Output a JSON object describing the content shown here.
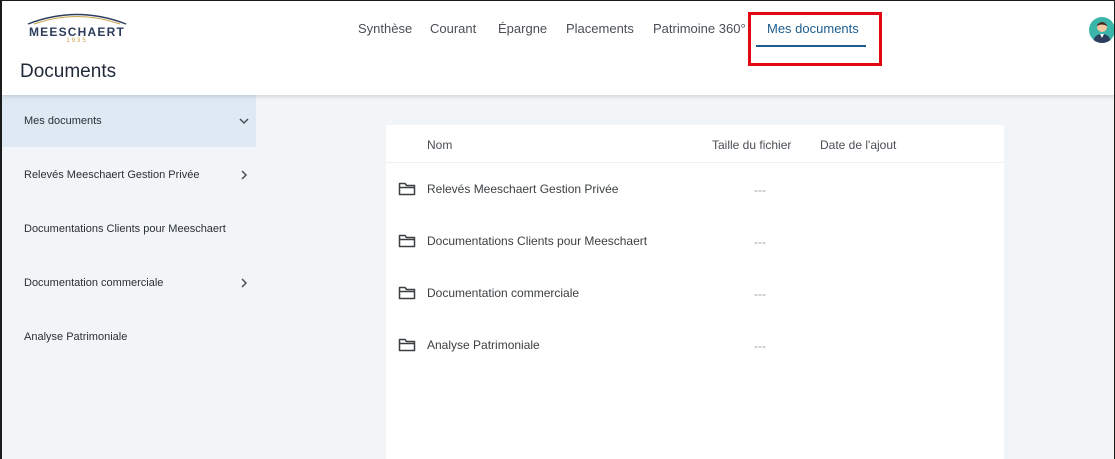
{
  "brand": {
    "name": "MEESCHAERT",
    "year": "1935"
  },
  "page": {
    "title": "Documents"
  },
  "nav": {
    "tabs": [
      {
        "label": "Synthèse"
      },
      {
        "label": "Courant"
      },
      {
        "label": "Épargne"
      },
      {
        "label": "Placements"
      },
      {
        "label": "Patrimoine 360°"
      },
      {
        "label": "Mes documents",
        "active": true
      }
    ]
  },
  "sidebar": {
    "items": [
      {
        "label": "Mes documents",
        "chevron": "chevron-down-icon",
        "active": true
      },
      {
        "label": "Relevés Meeschaert Gestion Privée",
        "chevron": "chevron-right-icon"
      },
      {
        "label": "Documentations Clients pour Meeschaert"
      },
      {
        "label": "Documentation commerciale",
        "chevron": "chevron-right-icon"
      },
      {
        "label": "Analyse Patrimoniale"
      }
    ]
  },
  "table": {
    "columns": {
      "name": "Nom",
      "size": "Taille du fichier",
      "date": "Date de l'ajout"
    },
    "rows": [
      {
        "name": "Relevés Meeschaert Gestion Privée",
        "size": "---",
        "icon": "folder-icon"
      },
      {
        "name": "Documentations Clients pour Meeschaert",
        "size": "---",
        "icon": "folder-icon"
      },
      {
        "name": "Documentation commerciale",
        "size": "---",
        "icon": "folder-icon"
      },
      {
        "name": "Analyse Patrimoniale",
        "size": "---",
        "icon": "folder-icon"
      }
    ]
  },
  "colors": {
    "accent": "#1c5d8e",
    "highlight": "#e30613",
    "sidebar_bg": "#f2f5f8",
    "sidebar_active_bg": "#dfe9f3",
    "brand_gold": "#c9a34a",
    "avatar_bg": "#3ab5a9"
  }
}
